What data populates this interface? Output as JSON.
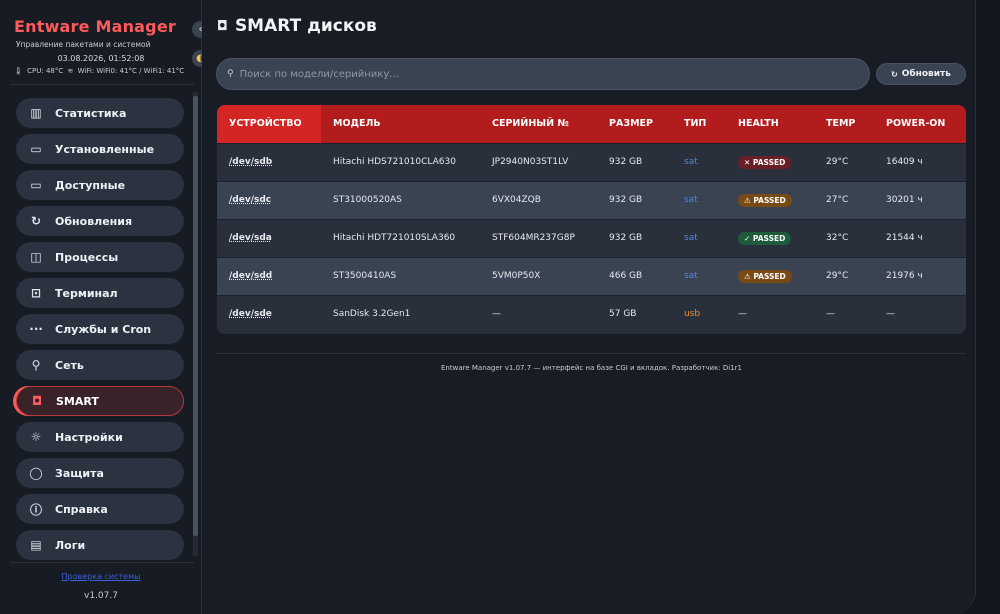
{
  "app": {
    "brand": "Entware Manager",
    "subtitle": "Управление пакетами и системой",
    "datetime": "03.08.2026, 01:52:08",
    "sensors": {
      "cpu": "CPU: 48°C",
      "wifi": "WiFi: WiFi0: 41°C / WiFi1: 41°C"
    },
    "collapse_icon": "chevron-left-icon",
    "theme_icon": "theme-toggle-icon"
  },
  "nav": {
    "items": [
      {
        "label": "Статистика",
        "icon": "stats-icon",
        "glyph": "▥"
      },
      {
        "label": "Установленные",
        "icon": "package-icon",
        "glyph": "▭"
      },
      {
        "label": "Доступные",
        "icon": "package-icon",
        "glyph": "▭"
      },
      {
        "label": "Обновления",
        "icon": "refresh-icon",
        "glyph": "↻"
      },
      {
        "label": "Процессы",
        "icon": "chart-icon",
        "glyph": "◫"
      },
      {
        "label": "Терминал",
        "icon": "terminal-icon",
        "glyph": "⊡"
      },
      {
        "label": "Службы и Cron",
        "icon": "dots-icon",
        "glyph": "∙∙∙"
      },
      {
        "label": "Сеть",
        "icon": "network-icon",
        "glyph": "⚲"
      },
      {
        "label": "SMART",
        "icon": "disk-icon",
        "glyph": "◘"
      },
      {
        "label": "Настройки",
        "icon": "gear-icon",
        "glyph": "☼"
      },
      {
        "label": "Защита",
        "icon": "shield-icon",
        "glyph": "◯"
      },
      {
        "label": "Справка",
        "icon": "info-icon",
        "glyph": "ⓘ"
      },
      {
        "label": "Логи",
        "icon": "log-icon",
        "glyph": "▤"
      }
    ],
    "active": "SMART"
  },
  "sidebar_footer": {
    "link": "Проверка системы",
    "version": "v1.07.7"
  },
  "main": {
    "title": "SMART дисков",
    "title_icon": "disk-icon",
    "search": {
      "placeholder": "Поиск по модели/серийнику..."
    },
    "refresh_label": "Обновить",
    "table": {
      "headers": [
        "УСТРОЙСТВО",
        "МОДЕЛЬ",
        "СЕРИЙНЫЙ №",
        "РАЗМЕР",
        "ТИП",
        "HEALTH",
        "TEMP",
        "POWER-ON"
      ],
      "rows": [
        {
          "device": "/dev/sdb",
          "model": "Hitachi HDS721010CLA630",
          "serial": "JP2940N03ST1LV",
          "size": "932 GB",
          "type": "sat",
          "health": "✕ PASSED",
          "health_status": "red",
          "temp": "29°C",
          "power_on": "16409 ч"
        },
        {
          "device": "/dev/sdc",
          "model": "ST31000520AS",
          "serial": "6VX04ZQB",
          "size": "932 GB",
          "type": "sat",
          "health": "⚠ PASSED",
          "health_status": "orange",
          "temp": "27°C",
          "power_on": "30201 ч"
        },
        {
          "device": "/dev/sda",
          "model": "Hitachi HDT721010SLA360",
          "serial": "STF604MR237G8P",
          "size": "932 GB",
          "type": "sat",
          "health": "✓ PASSED",
          "health_status": "green",
          "temp": "32°C",
          "power_on": "21544 ч"
        },
        {
          "device": "/dev/sdd",
          "model": "ST3500410AS",
          "serial": "5VM0P50X",
          "size": "466 GB",
          "type": "sat",
          "health": "⚠ PASSED",
          "health_status": "orange",
          "temp": "29°C",
          "power_on": "21976 ч"
        },
        {
          "device": "/dev/sde",
          "model": "SanDisk 3.2Gen1",
          "serial": "—",
          "size": "57 GB",
          "type": "usb",
          "health": "—",
          "health_status": "none",
          "temp": "—",
          "power_on": "—"
        }
      ]
    },
    "footer": "Entware Manager v1.07.7 — интерфейс на базе CGI и вкладок. Разработчик: Di1r1"
  },
  "colors": {
    "accent": "#ff5a5a",
    "header_red": "#b31c1c",
    "sat": "#4f86e0",
    "usb": "#f08a24"
  }
}
